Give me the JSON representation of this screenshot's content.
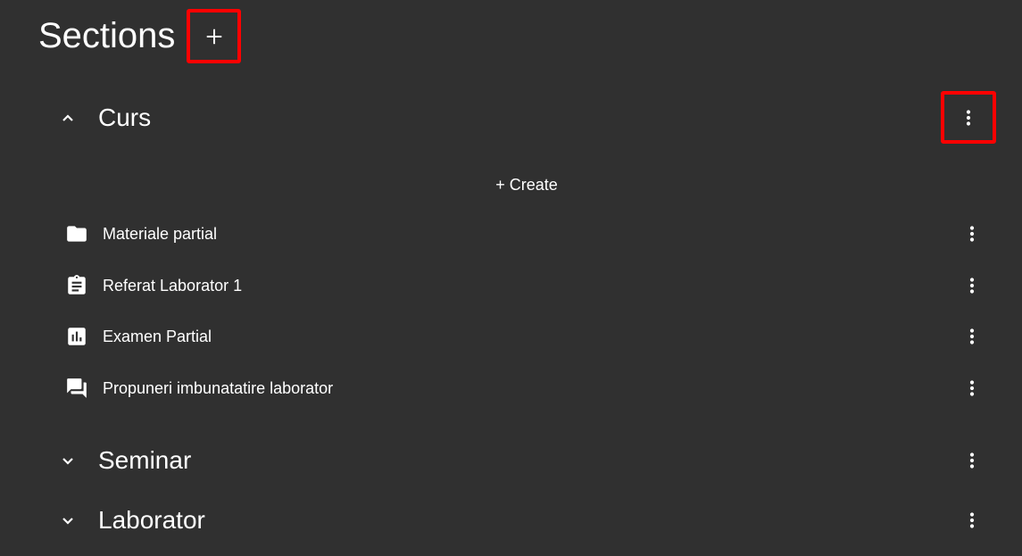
{
  "header": {
    "title": "Sections",
    "add_icon": "plus-icon"
  },
  "sections": [
    {
      "title": "Curs",
      "expanded": true,
      "create_label": "+ Create",
      "items": [
        {
          "label": "Materiale partial",
          "icon": "folder-icon"
        },
        {
          "label": "Referat Laborator 1",
          "icon": "assignment-icon"
        },
        {
          "label": "Examen Partial",
          "icon": "bar-chart-icon"
        },
        {
          "label": "Propuneri imbunatatire laborator",
          "icon": "forum-icon"
        }
      ]
    },
    {
      "title": "Seminar",
      "expanded": false
    },
    {
      "title": "Laborator",
      "expanded": false
    }
  ],
  "colors": {
    "background": "#303030",
    "text": "#ffffff",
    "highlight": "#ff0000"
  }
}
